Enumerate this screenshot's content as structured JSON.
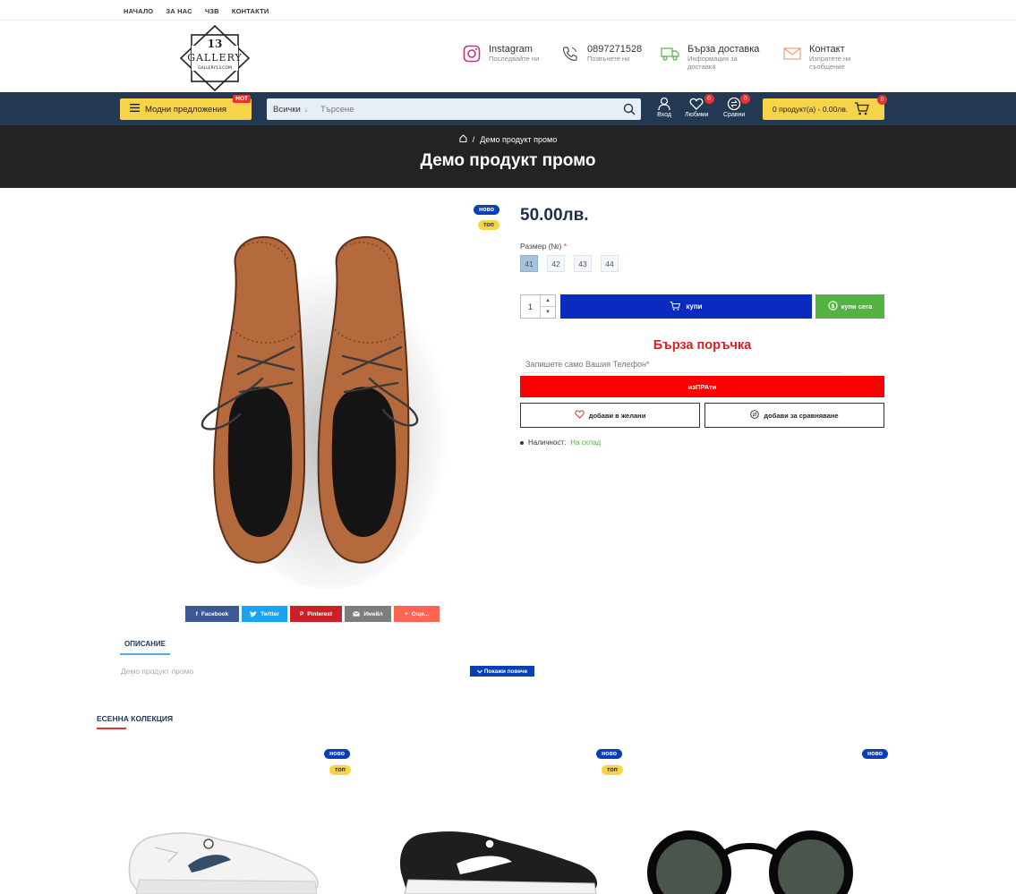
{
  "topbar": {
    "links": [
      "НАЧАЛО",
      "ЗА НАС",
      "ЧЗВ",
      "КОНТАКТИ"
    ]
  },
  "logo": {
    "number": "13",
    "name": "GALLERY",
    "domain": "GALLERY13.COM"
  },
  "header": {
    "instagram": {
      "title": "Instagram",
      "sub": "Последвайте ни"
    },
    "phone": {
      "title": "0897271528",
      "sub": "Позвънете ни"
    },
    "delivery": {
      "title": "Бърза доставка",
      "sub1": "Информация за",
      "sub2": "доставка"
    },
    "contact": {
      "title": "Контакт",
      "sub1": "Изпратете ни",
      "sub2": "съобщение"
    }
  },
  "nav": {
    "deals_label": "Модни предложения",
    "hot_badge": "HOT",
    "search_category": "Всички",
    "search_placeholder": "Търсене",
    "login_label": "Вход",
    "wishlist_label": "Любими",
    "wishlist_count": "0",
    "compare_label": "Сравни",
    "compare_count": "0",
    "cart_label": "0 продукт(а) - 0.00лв.",
    "cart_count": "0"
  },
  "page": {
    "breadcrumb_current": "Демо продукт промо",
    "title": "Демо продукт промо"
  },
  "product": {
    "tag_new": "ново",
    "tag_top": "топ",
    "price": "50.00лв.",
    "size_label": "Размер (№)",
    "size_required": "*",
    "sizes": [
      "41",
      "42",
      "43",
      "44"
    ],
    "selected_size": "41",
    "quantity": "1",
    "buy_label": "купи",
    "buy_now_label": "купи сега",
    "quick_order_title": "Бърза поръчка",
    "phone_placeholder": "Запишете само Вашия Телефон*",
    "send_label": "изПРАти",
    "wishlist_label": "добави в желани",
    "compare_label": "добави за сравняване",
    "availability_label": "Наличност:",
    "availability_value": "На склад"
  },
  "share": {
    "facebook": "Facebook",
    "twitter": "Twitter",
    "pinterest": "Pinterest",
    "email": "Имейл",
    "more": "Още..."
  },
  "description": {
    "tab_label": "ОПИСАНИЕ",
    "text": "Демо продукт промо",
    "show_more": "Покажи повече"
  },
  "collection": {
    "title": "ЕСЕННА КОЛЕКЦИЯ",
    "cards": [
      {
        "tag_new": "ново",
        "tag_top": "топ"
      },
      {
        "tag_new": "ново",
        "tag_top": "топ"
      },
      {
        "tag_new": "ново"
      }
    ]
  },
  "colors": {
    "navbar": "#233852",
    "accent_yellow": "#f7d349",
    "buy_blue": "#0a2ac0",
    "buy_now_green": "#55b144",
    "send_red": "#fe0000",
    "title_bar": "#232323"
  }
}
